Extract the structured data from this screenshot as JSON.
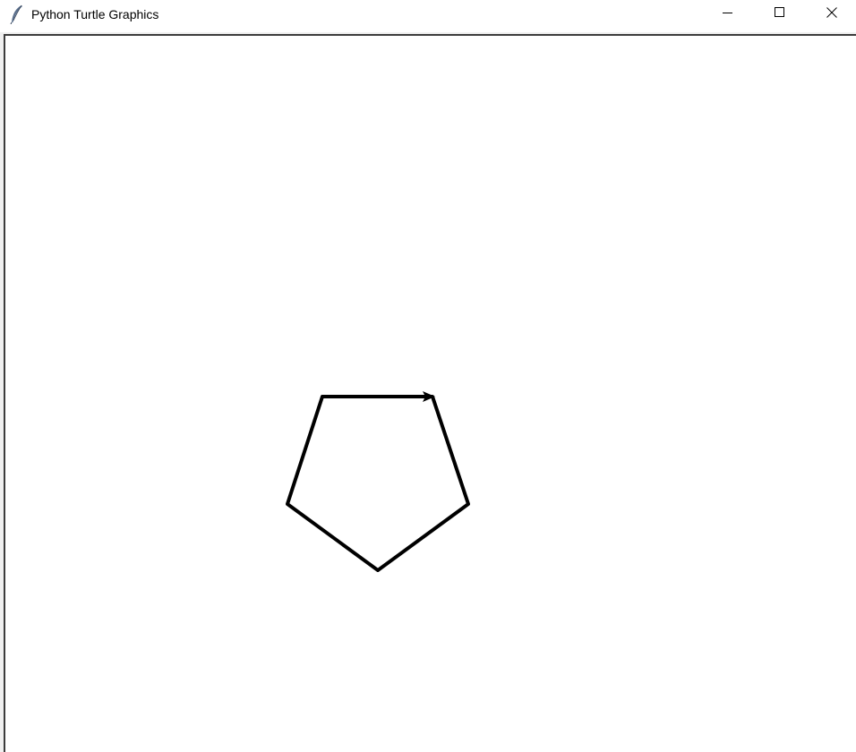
{
  "window": {
    "title": "Python Turtle Graphics",
    "icon": "feather-icon",
    "controls": {
      "minimize": "minimize-icon",
      "maximize": "maximize-icon",
      "close": "close-icon"
    }
  },
  "canvas": {
    "background": "#ffffff",
    "drawing": {
      "shape": "pentagon",
      "pen_color": "#000000",
      "turtle_shape": "classic-arrow",
      "turtle_heading": "east"
    }
  }
}
